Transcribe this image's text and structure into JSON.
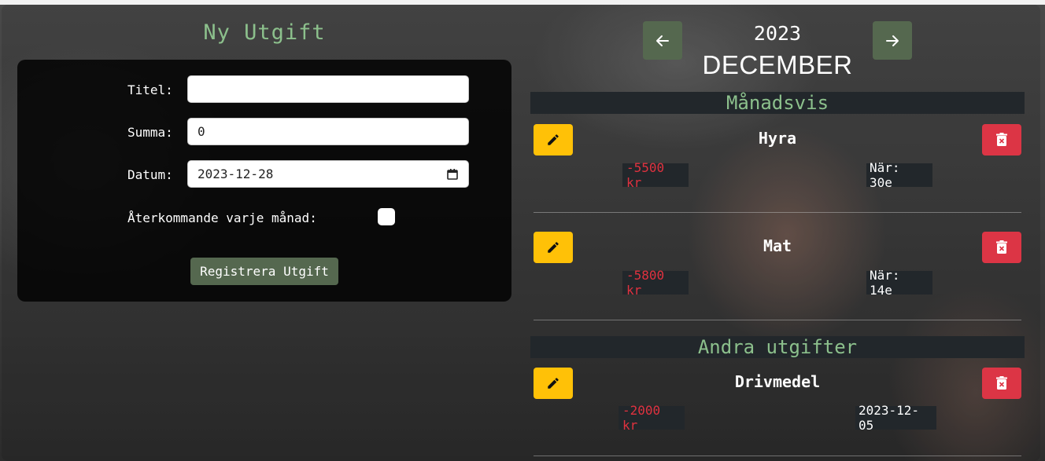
{
  "form": {
    "title": "Ny Utgift",
    "title_label": "Titel:",
    "title_value": "",
    "amount_label": "Summa:",
    "amount_value": "0",
    "date_label": "Datum:",
    "date_value": "2023-12-28",
    "recurring_label": "Återkommande varje månad:",
    "recurring_checked": false,
    "submit_label": "Registrera Utgift"
  },
  "nav": {
    "year": "2023",
    "month": "DECEMBER",
    "prev_icon": "arrow-left-icon",
    "next_icon": "arrow-right-icon"
  },
  "sections": {
    "monthly_title": "Månadsvis",
    "other_title": "Andra utgifter"
  },
  "monthly_items": [
    {
      "title": "Hyra",
      "amount": "-5500 kr",
      "when": "När: 30e"
    },
    {
      "title": "Mat",
      "amount": "-5800 kr",
      "when": "När: 14e"
    }
  ],
  "other_items": [
    {
      "title": "Drivmedel",
      "amount": "-2000 kr",
      "when": "2023-12-05"
    }
  ],
  "colors": {
    "accent_green": "#8cc08c",
    "button_green": "#55684f",
    "edit_yellow": "#ffc107",
    "delete_red": "#dc3545",
    "amount_red": "#e0323f"
  },
  "icons": {
    "edit": "pencil-icon",
    "delete": "trash-icon",
    "calendar": "calendar-icon"
  }
}
